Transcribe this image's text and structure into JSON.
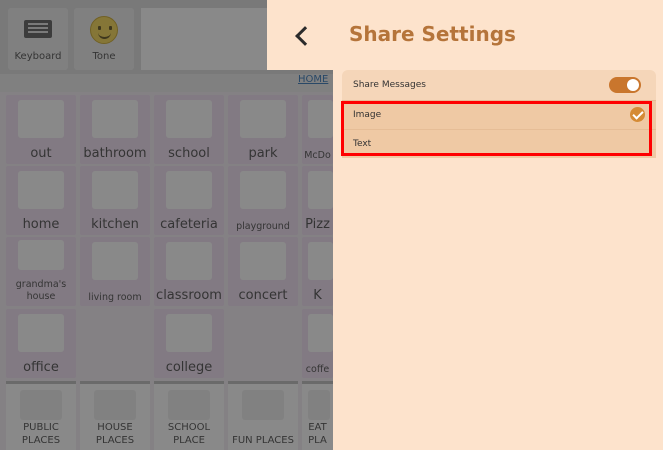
{
  "toolbar": {
    "keyboard_label": "Keyboard",
    "tone_label": "Tone",
    "home_link": "HOME"
  },
  "tiles": [
    {
      "label": "out"
    },
    {
      "label": "bathroom"
    },
    {
      "label": "school"
    },
    {
      "label": "park"
    },
    {
      "label": "McDo"
    },
    {
      "label": "home"
    },
    {
      "label": "kitchen"
    },
    {
      "label": "cafeteria"
    },
    {
      "label": "playground"
    },
    {
      "label": "Pizz"
    },
    {
      "label": "grandma's\nhouse"
    },
    {
      "label": "living room"
    },
    {
      "label": "classroom"
    },
    {
      "label": "concert"
    },
    {
      "label": "K"
    },
    {
      "label": "office"
    },
    {
      "label": "college"
    },
    {
      "label": "coffe"
    }
  ],
  "categories": [
    {
      "label": "PUBLIC\nPLACES"
    },
    {
      "label": "HOUSE\nPLACES"
    },
    {
      "label": "SCHOOL\nPLACE"
    },
    {
      "label": "FUN PLACES"
    },
    {
      "label": "EAT\nPLA"
    }
  ],
  "settings": {
    "title": "Share Settings",
    "rows": [
      {
        "label": "Share Messages",
        "control": "toggle",
        "on": true
      },
      {
        "label": "Image",
        "control": "check",
        "checked": true
      },
      {
        "label": "Text",
        "control": "check",
        "checked": false
      }
    ]
  },
  "colors": {
    "panel_bg": "#fde3cc",
    "title": "#b5743a",
    "accent": "#c9762d",
    "highlight": "#ff0000"
  }
}
